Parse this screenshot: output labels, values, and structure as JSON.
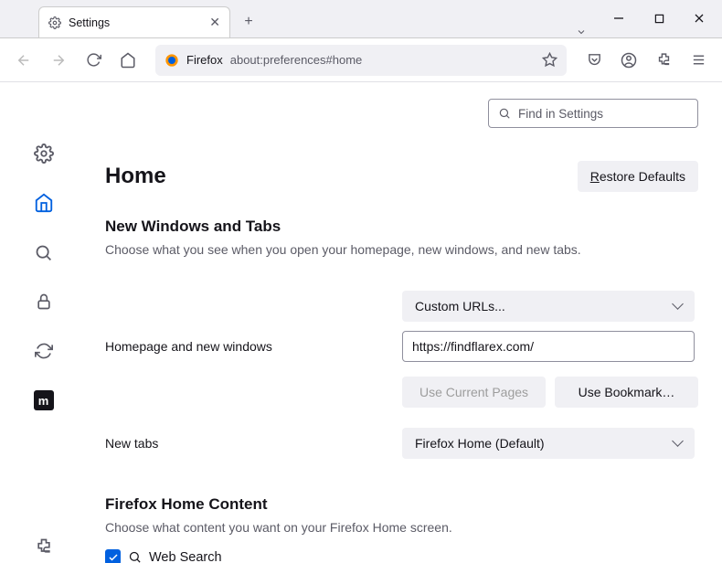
{
  "tab": {
    "title": "Settings"
  },
  "urlbar": {
    "identity": "Firefox",
    "url": "about:preferences#home"
  },
  "find_placeholder": "Find in Settings",
  "page_title": "Home",
  "restore_defaults": "Restore Defaults",
  "section1": {
    "heading": "New Windows and Tabs",
    "sub": "Choose what you see when you open your homepage, new windows, and new tabs."
  },
  "homepage": {
    "label": "Homepage and new windows",
    "dropdown": "Custom URLs...",
    "url_value": "https://findflarex.com/",
    "use_current": "Use Current Pages",
    "use_bookmark": "Use Bookmark…"
  },
  "newtabs": {
    "label": "New tabs",
    "dropdown": "Firefox Home (Default)"
  },
  "section2": {
    "heading": "Firefox Home Content",
    "sub": "Choose what content you want on your Firefox Home screen."
  },
  "websearch_label": "Web Search"
}
